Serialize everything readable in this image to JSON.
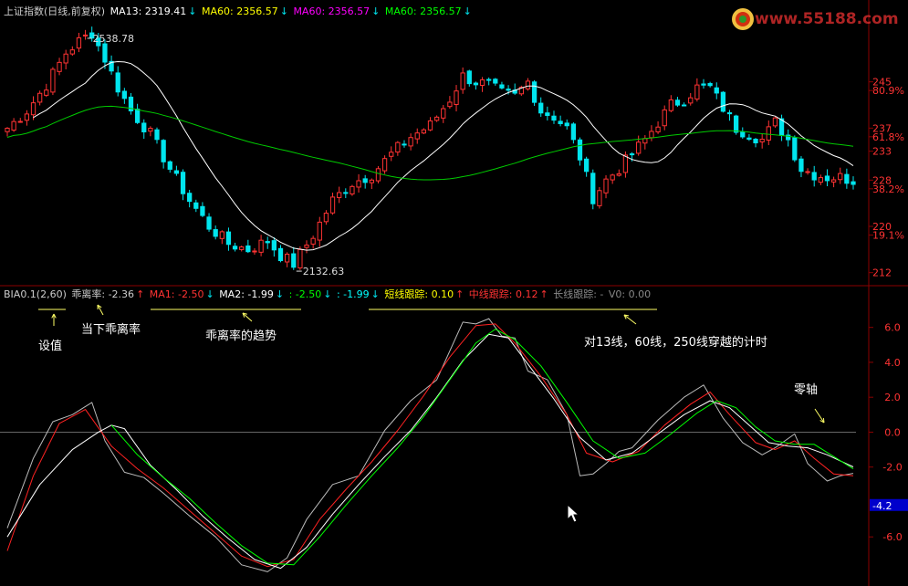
{
  "main_header": {
    "title": "上证指数(日线,前复权)",
    "items": [
      {
        "label": "MA13: 2319.41",
        "arrow": "↓",
        "color": "#ffffff"
      },
      {
        "label": "MA60: 2356.57",
        "arrow": "↓",
        "color": "#ffff00"
      },
      {
        "label": "MA60: 2356.57",
        "arrow": "↓",
        "color": "#ff00ff"
      },
      {
        "label": "MA60: 2356.57",
        "arrow": "↓",
        "color": "#00ff00"
      }
    ]
  },
  "logo": {
    "text": "www.55188.com"
  },
  "price_marks": {
    "high": "2538.78",
    "low": "2132.63"
  },
  "price_axis": [
    {
      "label": "245",
      "value": 2450,
      "color": "#ff3333"
    },
    {
      "label": "80.9%",
      "value": 2435,
      "color": "#ff3333"
    },
    {
      "label": "237",
      "value": 2370,
      "color": "#ff3333"
    },
    {
      "label": "61.8%",
      "value": 2355,
      "color": "#ff3333"
    },
    {
      "label": "233",
      "value": 2330,
      "color": "#ff3333"
    },
    {
      "label": "228",
      "value": 2280,
      "color": "#ff3333"
    },
    {
      "label": "38.2%",
      "value": 2265,
      "color": "#ff3333"
    },
    {
      "label": "220",
      "value": 2200,
      "color": "#ff3333"
    },
    {
      "label": "19.1%",
      "value": 2185,
      "color": "#ff3333"
    },
    {
      "label": "212",
      "value": 2120,
      "color": "#ff3333"
    }
  ],
  "indicator_header": {
    "items": [
      {
        "label": "BIA0.1(2,60)",
        "arrow": "",
        "color": "#cccccc"
      },
      {
        "label": "乖离率: -2.36",
        "arrow": "↑",
        "color": "#cccccc"
      },
      {
        "label": "MA1: -2.50",
        "arrow": "↓",
        "color": "#ff3333"
      },
      {
        "label": "MA2: -1.99",
        "arrow": "↓",
        "color": "#ffffff"
      },
      {
        "label": ": -2.50",
        "arrow": "↓",
        "color": "#00ff00"
      },
      {
        "label": ": -1.99",
        "arrow": "↓",
        "color": "#00ffff"
      },
      {
        "label": "短线跟踪: 0.10",
        "arrow": "↑",
        "color": "#ffff00"
      },
      {
        "label": "中线跟踪: 0.12",
        "arrow": "↑",
        "color": "#ff3333"
      },
      {
        "label": "长线跟踪: -",
        "arrow": "",
        "color": "#888888"
      },
      {
        "label": "V0: 0.00",
        "arrow": "",
        "color": "#888888"
      }
    ]
  },
  "indicator_axis": [
    {
      "label": "6.0",
      "value": 6
    },
    {
      "label": "4.0",
      "value": 4
    },
    {
      "label": "2.0",
      "value": 2
    },
    {
      "label": "0.0",
      "value": 0
    },
    {
      "label": "-2.0",
      "value": -2
    },
    {
      "label": "-6.0",
      "value": -6
    }
  ],
  "current_value_badge": "-4.2",
  "annotations": {
    "setting": "设值",
    "current_bias": "当下乖离率",
    "bias_trend": "乖离率的趋势",
    "cross_timing": "对13线，60线，250线穿越的计时",
    "zero_axis": "零轴"
  },
  "colors": {
    "up": "#ff3333",
    "down": "#00e5ee",
    "ma13": "#ffffff",
    "ma60": "#00cc00",
    "grid": "#8b0000",
    "bias": "#bbbbbb",
    "ma1": "#ff2222",
    "ma2": "#ffffff",
    "slow": "#00ff00",
    "badge": "#0000cc"
  },
  "chart_data": [
    {
      "type": "candlestick",
      "title": "上证指数(日线,前复权)",
      "x_count": 131,
      "ylim": [
        2110,
        2560
      ],
      "anchors": [
        [
          0,
          2370
        ],
        [
          3,
          2400
        ],
        [
          6,
          2445
        ],
        [
          9,
          2500
        ],
        [
          11,
          2520
        ],
        [
          13,
          2535
        ],
        [
          15,
          2490
        ],
        [
          17,
          2440
        ],
        [
          19,
          2400
        ],
        [
          22,
          2360
        ],
        [
          25,
          2300
        ],
        [
          28,
          2245
        ],
        [
          31,
          2200
        ],
        [
          34,
          2170
        ],
        [
          37,
          2160
        ],
        [
          40,
          2175
        ],
        [
          42,
          2150
        ],
        [
          44,
          2135
        ],
        [
          47,
          2185
        ],
        [
          50,
          2245
        ],
        [
          53,
          2275
        ],
        [
          56,
          2290
        ],
        [
          59,
          2325
        ],
        [
          62,
          2355
        ],
        [
          65,
          2375
        ],
        [
          68,
          2420
        ],
        [
          70,
          2460
        ],
        [
          72,
          2450
        ],
        [
          74,
          2445
        ],
        [
          76,
          2430
        ],
        [
          78,
          2425
        ],
        [
          80,
          2450
        ],
        [
          82,
          2400
        ],
        [
          84,
          2390
        ],
        [
          86,
          2370
        ],
        [
          88,
          2320
        ],
        [
          90,
          2250
        ],
        [
          92,
          2280
        ],
        [
          94,
          2300
        ],
        [
          96,
          2325
        ],
        [
          98,
          2350
        ],
        [
          100,
          2380
        ],
        [
          102,
          2410
        ],
        [
          104,
          2420
        ],
        [
          106,
          2440
        ],
        [
          108,
          2440
        ],
        [
          110,
          2405
        ],
        [
          112,
          2370
        ],
        [
          114,
          2360
        ],
        [
          116,
          2350
        ],
        [
          118,
          2380
        ],
        [
          120,
          2350
        ],
        [
          122,
          2300
        ],
        [
          124,
          2290
        ],
        [
          126,
          2285
        ],
        [
          128,
          2285
        ],
        [
          130,
          2280
        ]
      ],
      "ma_lines": [
        "MA13",
        "MA60"
      ]
    },
    {
      "type": "line",
      "title": "BIA0.1(2,60)",
      "x_count": 131,
      "ylim": [
        -8.5,
        7.5
      ],
      "series": [
        {
          "name": "乖离率",
          "points": [
            [
              0,
              -5.5
            ],
            [
              4,
              -1.5
            ],
            [
              7,
              0.6
            ],
            [
              10,
              1.0
            ],
            [
              13,
              1.7
            ],
            [
              15,
              -0.5
            ],
            [
              18,
              -2.3
            ],
            [
              21,
              -2.6
            ],
            [
              24,
              -3.5
            ],
            [
              28,
              -4.8
            ],
            [
              32,
              -6.0
            ],
            [
              36,
              -7.6
            ],
            [
              40,
              -8.0
            ],
            [
              43,
              -7.2
            ],
            [
              46,
              -5.0
            ],
            [
              50,
              -3.0
            ],
            [
              54,
              -2.5
            ],
            [
              58,
              0.1
            ],
            [
              62,
              1.8
            ],
            [
              66,
              3.0
            ],
            [
              70,
              6.3
            ],
            [
              72,
              6.2
            ],
            [
              74,
              6.5
            ],
            [
              76,
              5.5
            ],
            [
              78,
              5.4
            ],
            [
              80,
              3.5
            ],
            [
              83,
              3.0
            ],
            [
              86,
              1.0
            ],
            [
              88,
              -2.5
            ],
            [
              90,
              -2.4
            ],
            [
              92,
              -1.8
            ],
            [
              94,
              -1.1
            ],
            [
              96,
              -0.9
            ],
            [
              100,
              0.7
            ],
            [
              104,
              2.0
            ],
            [
              107,
              2.7
            ],
            [
              110,
              0.8
            ],
            [
              113,
              -0.6
            ],
            [
              116,
              -1.3
            ],
            [
              118,
              -0.9
            ],
            [
              121,
              -0.1
            ],
            [
              123,
              -1.8
            ],
            [
              126,
              -2.8
            ],
            [
              128,
              -2.5
            ],
            [
              130,
              -2.36
            ]
          ]
        },
        {
          "name": "MA1",
          "points": [
            [
              0,
              -6.8
            ],
            [
              4,
              -2.5
            ],
            [
              8,
              0.5
            ],
            [
              12,
              1.3
            ],
            [
              16,
              -0.8
            ],
            [
              20,
              -2.1
            ],
            [
              24,
              -3.2
            ],
            [
              28,
              -4.5
            ],
            [
              32,
              -5.8
            ],
            [
              36,
              -7.1
            ],
            [
              40,
              -7.7
            ],
            [
              44,
              -7.3
            ],
            [
              48,
              -5.0
            ],
            [
              52,
              -3.3
            ],
            [
              56,
              -1.7
            ],
            [
              60,
              0.1
            ],
            [
              64,
              2.1
            ],
            [
              68,
              4.3
            ],
            [
              72,
              6.1
            ],
            [
              75,
              6.2
            ],
            [
              78,
              5.1
            ],
            [
              82,
              3.2
            ],
            [
              86,
              1.0
            ],
            [
              89,
              -1.2
            ],
            [
              93,
              -1.7
            ],
            [
              97,
              -1.1
            ],
            [
              101,
              0.4
            ],
            [
              105,
              1.6
            ],
            [
              108,
              2.3
            ],
            [
              111,
              1.0
            ],
            [
              115,
              -0.6
            ],
            [
              118,
              -1.0
            ],
            [
              121,
              -0.5
            ],
            [
              124,
              -1.5
            ],
            [
              127,
              -2.4
            ],
            [
              130,
              -2.5
            ]
          ]
        },
        {
          "name": "MA2",
          "points": [
            [
              0,
              -6.0
            ],
            [
              5,
              -3.0
            ],
            [
              10,
              -1.0
            ],
            [
              14,
              0.0
            ],
            [
              16,
              0.4
            ],
            [
              18,
              0.2
            ],
            [
              22,
              -1.9
            ],
            [
              26,
              -3.3
            ],
            [
              30,
              -4.8
            ],
            [
              34,
              -6.1
            ],
            [
              38,
              -7.3
            ],
            [
              42,
              -7.8
            ],
            [
              46,
              -6.6
            ],
            [
              50,
              -4.7
            ],
            [
              54,
              -3.0
            ],
            [
              58,
              -1.4
            ],
            [
              62,
              0.1
            ],
            [
              66,
              2.0
            ],
            [
              70,
              4.1
            ],
            [
              74,
              5.6
            ],
            [
              77,
              5.4
            ],
            [
              80,
              3.9
            ],
            [
              84,
              1.9
            ],
            [
              88,
              -0.3
            ],
            [
              92,
              -1.6
            ],
            [
              96,
              -1.2
            ],
            [
              100,
              -0.1
            ],
            [
              104,
              1.0
            ],
            [
              108,
              1.8
            ],
            [
              111,
              1.4
            ],
            [
              114,
              0.4
            ],
            [
              117,
              -0.6
            ],
            [
              120,
              -0.8
            ],
            [
              123,
              -0.9
            ],
            [
              126,
              -1.3
            ],
            [
              130,
              -1.99
            ]
          ]
        },
        {
          "name": "",
          "points": [
            [
              16,
              0.4
            ],
            [
              20,
              -1.3
            ],
            [
              24,
              -2.6
            ],
            [
              28,
              -3.8
            ],
            [
              32,
              -5.2
            ],
            [
              36,
              -6.5
            ],
            [
              40,
              -7.5
            ],
            [
              44,
              -7.6
            ],
            [
              48,
              -6.0
            ],
            [
              52,
              -4.2
            ],
            [
              56,
              -2.5
            ],
            [
              60,
              -0.9
            ],
            [
              64,
              0.9
            ],
            [
              68,
              3.0
            ],
            [
              72,
              5.1
            ],
            [
              75,
              5.9
            ],
            [
              78,
              5.3
            ],
            [
              82,
              3.8
            ],
            [
              86,
              1.7
            ],
            [
              90,
              -0.5
            ],
            [
              94,
              -1.5
            ],
            [
              98,
              -1.2
            ],
            [
              102,
              -0.1
            ],
            [
              106,
              1.1
            ],
            [
              109,
              1.8
            ],
            [
              112,
              1.4
            ],
            [
              115,
              0.3
            ],
            [
              118,
              -0.5
            ],
            [
              121,
              -0.7
            ],
            [
              124,
              -0.7
            ],
            [
              127,
              -1.4
            ],
            [
              130,
              -2.1
            ]
          ]
        }
      ]
    }
  ]
}
